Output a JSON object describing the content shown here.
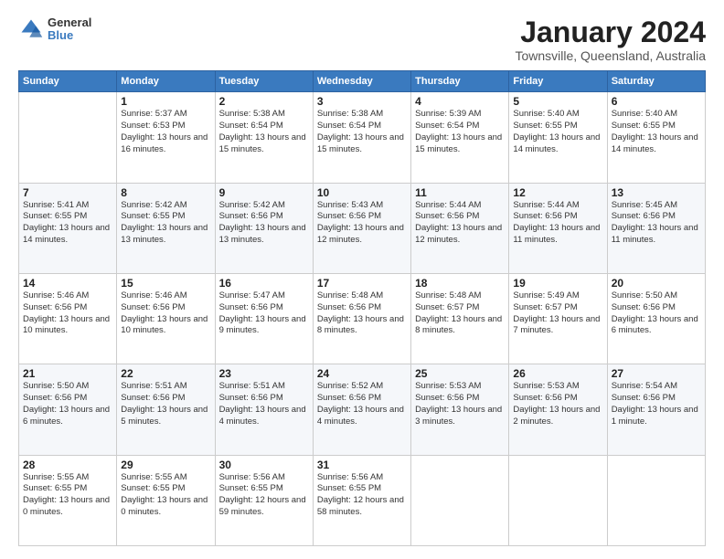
{
  "logo": {
    "general": "General",
    "blue": "Blue"
  },
  "header": {
    "month": "January 2024",
    "location": "Townsville, Queensland, Australia"
  },
  "weekdays": [
    "Sunday",
    "Monday",
    "Tuesday",
    "Wednesday",
    "Thursday",
    "Friday",
    "Saturday"
  ],
  "weeks": [
    [
      {
        "day": "",
        "info": ""
      },
      {
        "day": "1",
        "info": "Sunrise: 5:37 AM\nSunset: 6:53 PM\nDaylight: 13 hours\nand 16 minutes."
      },
      {
        "day": "2",
        "info": "Sunrise: 5:38 AM\nSunset: 6:54 PM\nDaylight: 13 hours\nand 15 minutes."
      },
      {
        "day": "3",
        "info": "Sunrise: 5:38 AM\nSunset: 6:54 PM\nDaylight: 13 hours\nand 15 minutes."
      },
      {
        "day": "4",
        "info": "Sunrise: 5:39 AM\nSunset: 6:54 PM\nDaylight: 13 hours\nand 15 minutes."
      },
      {
        "day": "5",
        "info": "Sunrise: 5:40 AM\nSunset: 6:55 PM\nDaylight: 13 hours\nand 14 minutes."
      },
      {
        "day": "6",
        "info": "Sunrise: 5:40 AM\nSunset: 6:55 PM\nDaylight: 13 hours\nand 14 minutes."
      }
    ],
    [
      {
        "day": "7",
        "info": "Sunrise: 5:41 AM\nSunset: 6:55 PM\nDaylight: 13 hours\nand 14 minutes."
      },
      {
        "day": "8",
        "info": "Sunrise: 5:42 AM\nSunset: 6:55 PM\nDaylight: 13 hours\nand 13 minutes."
      },
      {
        "day": "9",
        "info": "Sunrise: 5:42 AM\nSunset: 6:56 PM\nDaylight: 13 hours\nand 13 minutes."
      },
      {
        "day": "10",
        "info": "Sunrise: 5:43 AM\nSunset: 6:56 PM\nDaylight: 13 hours\nand 12 minutes."
      },
      {
        "day": "11",
        "info": "Sunrise: 5:44 AM\nSunset: 6:56 PM\nDaylight: 13 hours\nand 12 minutes."
      },
      {
        "day": "12",
        "info": "Sunrise: 5:44 AM\nSunset: 6:56 PM\nDaylight: 13 hours\nand 11 minutes."
      },
      {
        "day": "13",
        "info": "Sunrise: 5:45 AM\nSunset: 6:56 PM\nDaylight: 13 hours\nand 11 minutes."
      }
    ],
    [
      {
        "day": "14",
        "info": "Sunrise: 5:46 AM\nSunset: 6:56 PM\nDaylight: 13 hours\nand 10 minutes."
      },
      {
        "day": "15",
        "info": "Sunrise: 5:46 AM\nSunset: 6:56 PM\nDaylight: 13 hours\nand 10 minutes."
      },
      {
        "day": "16",
        "info": "Sunrise: 5:47 AM\nSunset: 6:56 PM\nDaylight: 13 hours\nand 9 minutes."
      },
      {
        "day": "17",
        "info": "Sunrise: 5:48 AM\nSunset: 6:56 PM\nDaylight: 13 hours\nand 8 minutes."
      },
      {
        "day": "18",
        "info": "Sunrise: 5:48 AM\nSunset: 6:57 PM\nDaylight: 13 hours\nand 8 minutes."
      },
      {
        "day": "19",
        "info": "Sunrise: 5:49 AM\nSunset: 6:57 PM\nDaylight: 13 hours\nand 7 minutes."
      },
      {
        "day": "20",
        "info": "Sunrise: 5:50 AM\nSunset: 6:56 PM\nDaylight: 13 hours\nand 6 minutes."
      }
    ],
    [
      {
        "day": "21",
        "info": "Sunrise: 5:50 AM\nSunset: 6:56 PM\nDaylight: 13 hours\nand 6 minutes."
      },
      {
        "day": "22",
        "info": "Sunrise: 5:51 AM\nSunset: 6:56 PM\nDaylight: 13 hours\nand 5 minutes."
      },
      {
        "day": "23",
        "info": "Sunrise: 5:51 AM\nSunset: 6:56 PM\nDaylight: 13 hours\nand 4 minutes."
      },
      {
        "day": "24",
        "info": "Sunrise: 5:52 AM\nSunset: 6:56 PM\nDaylight: 13 hours\nand 4 minutes."
      },
      {
        "day": "25",
        "info": "Sunrise: 5:53 AM\nSunset: 6:56 PM\nDaylight: 13 hours\nand 3 minutes."
      },
      {
        "day": "26",
        "info": "Sunrise: 5:53 AM\nSunset: 6:56 PM\nDaylight: 13 hours\nand 2 minutes."
      },
      {
        "day": "27",
        "info": "Sunrise: 5:54 AM\nSunset: 6:56 PM\nDaylight: 13 hours\nand 1 minute."
      }
    ],
    [
      {
        "day": "28",
        "info": "Sunrise: 5:55 AM\nSunset: 6:55 PM\nDaylight: 13 hours\nand 0 minutes."
      },
      {
        "day": "29",
        "info": "Sunrise: 5:55 AM\nSunset: 6:55 PM\nDaylight: 13 hours\nand 0 minutes."
      },
      {
        "day": "30",
        "info": "Sunrise: 5:56 AM\nSunset: 6:55 PM\nDaylight: 12 hours\nand 59 minutes."
      },
      {
        "day": "31",
        "info": "Sunrise: 5:56 AM\nSunset: 6:55 PM\nDaylight: 12 hours\nand 58 minutes."
      },
      {
        "day": "",
        "info": ""
      },
      {
        "day": "",
        "info": ""
      },
      {
        "day": "",
        "info": ""
      }
    ]
  ]
}
